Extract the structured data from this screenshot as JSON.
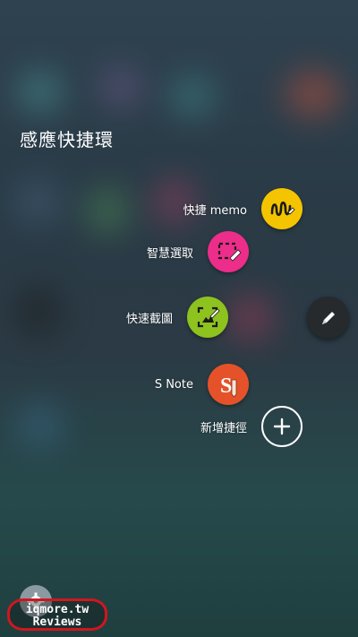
{
  "panel": {
    "title": "感應快捷環"
  },
  "shortcuts": [
    {
      "label": "快捷 memo",
      "icon": "memo-pen-icon",
      "color": "#f4c400"
    },
    {
      "label": "智慧選取",
      "icon": "smart-select-icon",
      "color": "#ec2d8a"
    },
    {
      "label": "快速截圖",
      "icon": "screen-write-icon",
      "color": "#8dc21f"
    },
    {
      "label": "S Note",
      "icon": "s-note-icon",
      "color": "#e5522a"
    }
  ],
  "add_shortcut": {
    "label": "新增捷徑",
    "icon": "plus-icon"
  },
  "pen_button": {
    "icon": "pen-icon",
    "color": "#262a2d"
  },
  "settings": {
    "icon": "gear-icon"
  },
  "watermark": {
    "line1": "iqmore.tw",
    "line2": "Reviews"
  }
}
